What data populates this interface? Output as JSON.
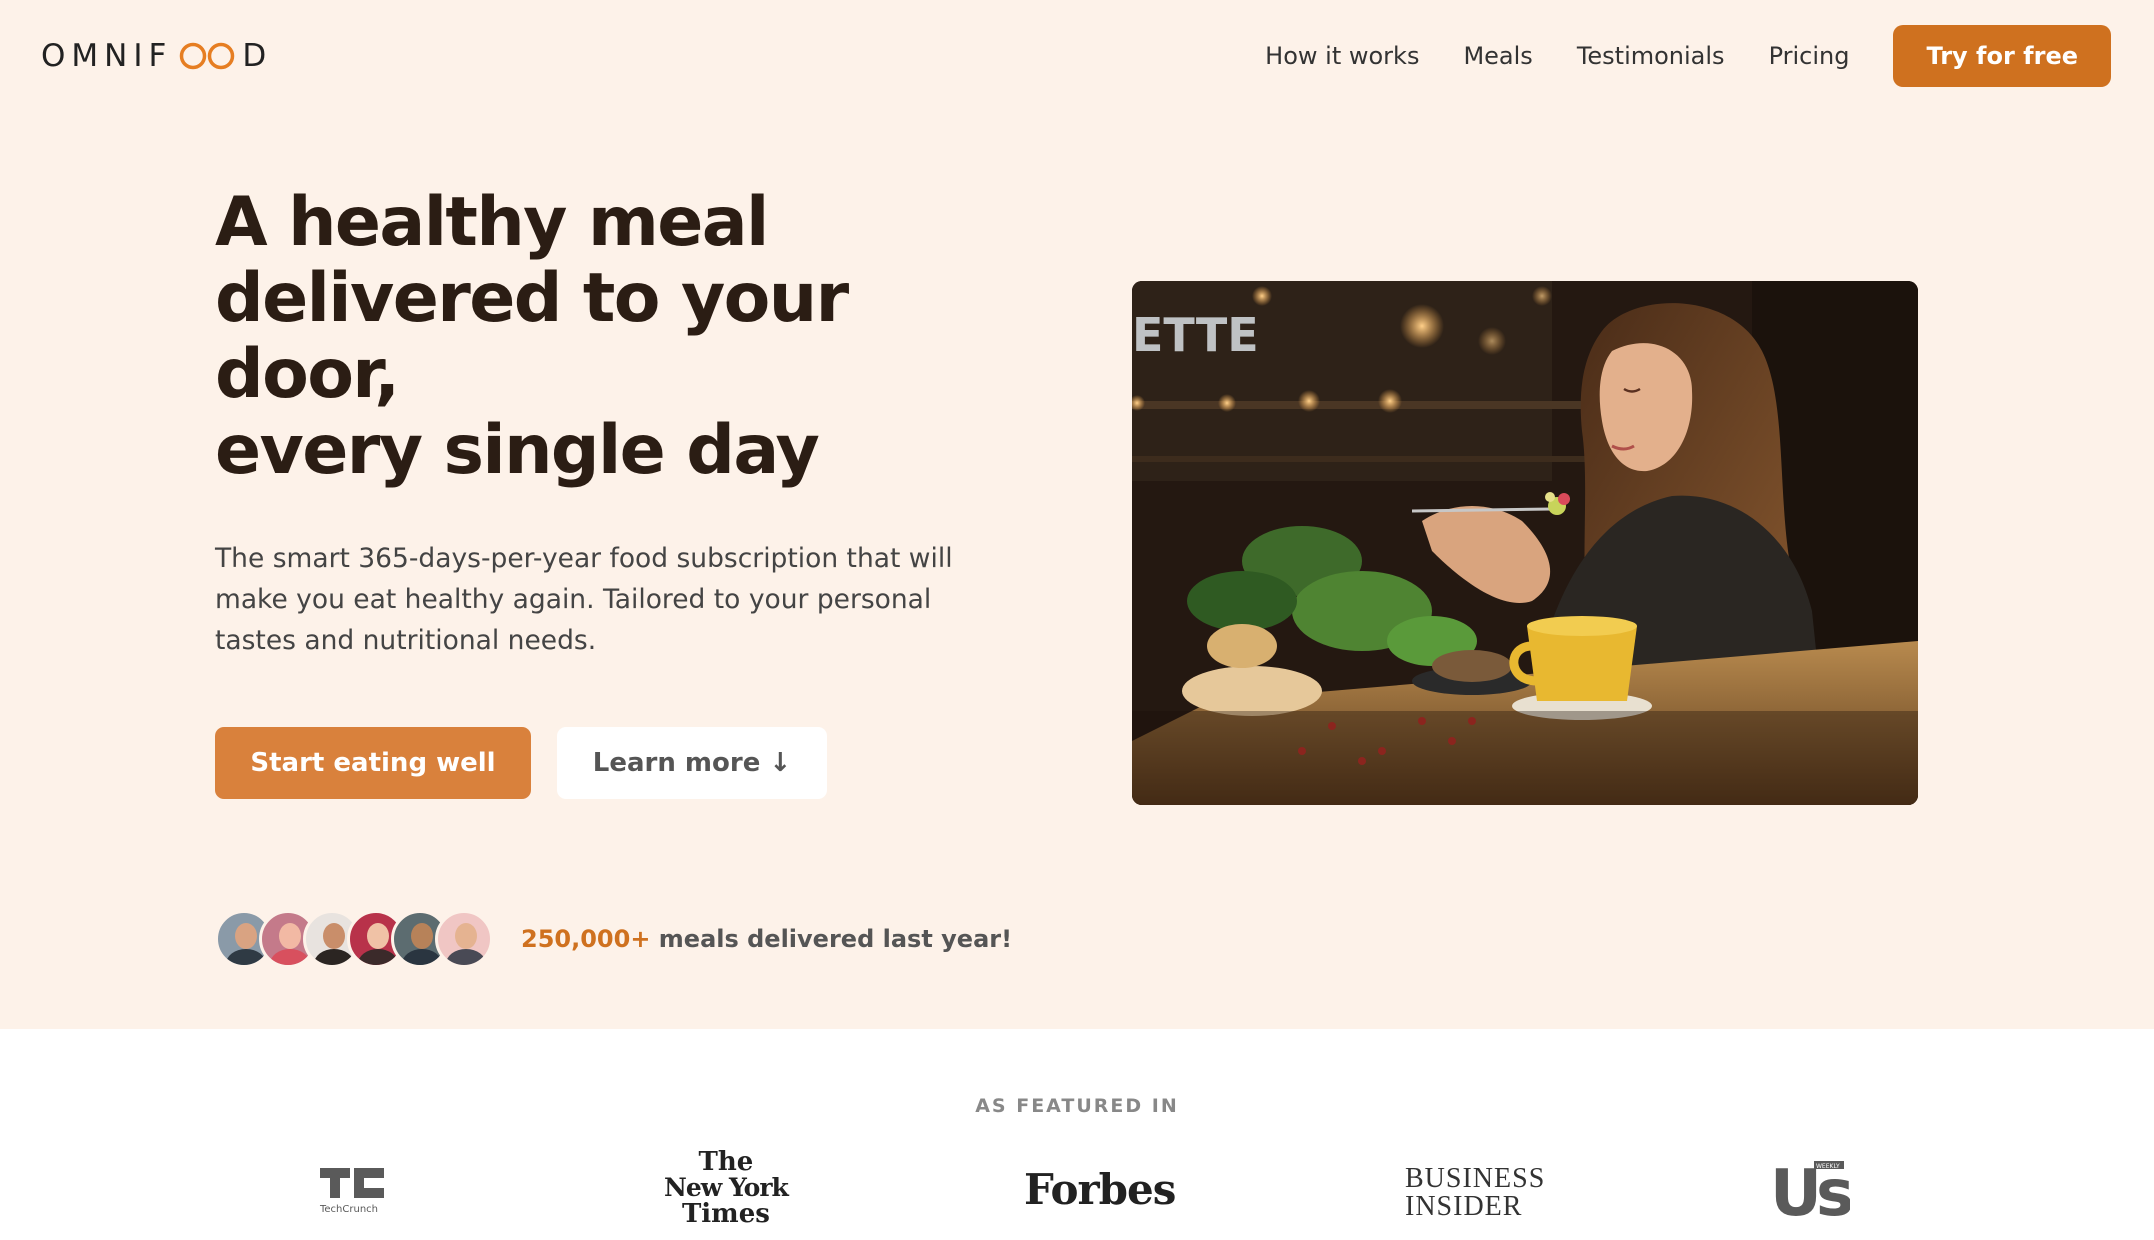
{
  "header": {
    "logo_left": "OMNIF",
    "logo_right": "D",
    "nav": [
      "How it works",
      "Meals",
      "Testimonials",
      "Pricing"
    ],
    "cta": "Try for free"
  },
  "hero": {
    "title_line1": "A healthy meal",
    "title_line2": "delivered to your door,",
    "title_line3": "every single day",
    "description": "The smart 365-days-per-year food subscription that will make you eat healthy again. Tailored to your personal tastes and nutritional needs.",
    "primary_button": "Start eating well",
    "secondary_button": "Learn more ↓",
    "delivered_number": "250,000+",
    "delivered_text": " meals delivered last year!",
    "image_sign": "ETTE"
  },
  "featured": {
    "heading": "AS FEATURED IN",
    "logos": [
      "TechCrunch",
      "The New York Times",
      "Forbes",
      "Business Insider",
      "Us Weekly"
    ],
    "techcrunch_caption": "TechCrunch",
    "nyt_line1": "The",
    "nyt_line2": "New York",
    "nyt_line3": "Times",
    "forbes_text": "Forbes",
    "bi_line1": "BUSINESS",
    "bi_line2": "INSIDER",
    "us_text": "Us",
    "us_small": "WEEKLY"
  },
  "colors": {
    "primary": "#e67e22",
    "primary_dark": "#cf711f",
    "background": "#fdf2e9"
  }
}
